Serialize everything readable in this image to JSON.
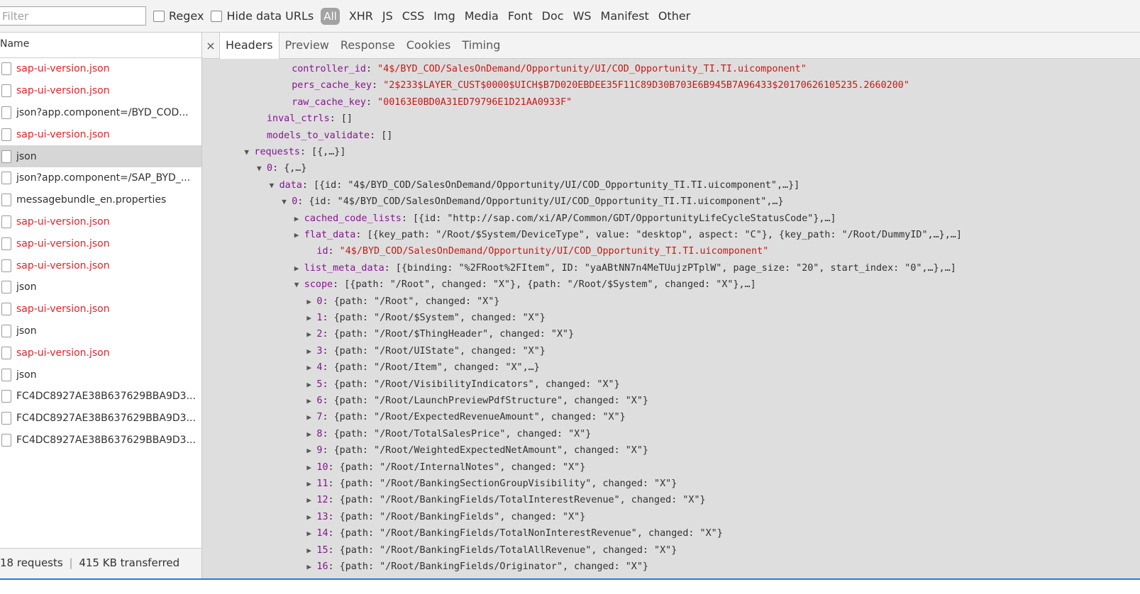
{
  "toolbar": {
    "filter_placeholder": "Filter",
    "regex_label": "Regex",
    "hide_data_urls_label": "Hide data URLs",
    "types": [
      "All",
      "XHR",
      "JS",
      "CSS",
      "Img",
      "Media",
      "Font",
      "Doc",
      "WS",
      "Manifest",
      "Other"
    ],
    "selected_type": "All"
  },
  "requests_panel": {
    "header": "Name",
    "items": [
      {
        "name": "sap-ui-version.json",
        "error": true
      },
      {
        "name": "sap-ui-version.json",
        "error": true
      },
      {
        "name": "json?app.component=/BYD_COD...",
        "error": false
      },
      {
        "name": "sap-ui-version.json",
        "error": true
      },
      {
        "name": "json",
        "error": false,
        "selected": true
      },
      {
        "name": "json?app.component=/SAP_BYD_...",
        "error": false
      },
      {
        "name": "messagebundle_en.properties",
        "error": false
      },
      {
        "name": "sap-ui-version.json",
        "error": true
      },
      {
        "name": "sap-ui-version.json",
        "error": true
      },
      {
        "name": "sap-ui-version.json",
        "error": true
      },
      {
        "name": "json",
        "error": false
      },
      {
        "name": "sap-ui-version.json",
        "error": true
      },
      {
        "name": "json",
        "error": false
      },
      {
        "name": "sap-ui-version.json",
        "error": true
      },
      {
        "name": "json",
        "error": false
      },
      {
        "name": "FC4DC8927AE38B637629BBA9D3...",
        "error": false
      },
      {
        "name": "FC4DC8927AE38B637629BBA9D3...",
        "error": false
      },
      {
        "name": "FC4DC8927AE38B637629BBA9D3...",
        "error": false
      }
    ],
    "summary_requests": "18 requests",
    "summary_sep": "|",
    "summary_transferred": "415 KB transferred"
  },
  "details": {
    "close": "×",
    "tabs": [
      "Headers",
      "Preview",
      "Response",
      "Cookies",
      "Timing"
    ],
    "active_tab": "Headers"
  },
  "json_lines": [
    {
      "indent": 7,
      "tri": "",
      "key": "controller_id",
      "sep": ": ",
      "val": "\"4$/BYD_COD/SalesOnDemand/Opportunity/UI/COD_Opportunity_TI.TI.uicomponent\"",
      "vt": "str"
    },
    {
      "indent": 7,
      "tri": "",
      "key": "pers_cache_key",
      "sep": ": ",
      "val": "\"2$233$LAYER_CUST$0000$UICH$B7D020EBDEE35F11C89D30B703E6B945B7A96433$20170626105235.2660200\"",
      "vt": "str"
    },
    {
      "indent": 7,
      "tri": "",
      "key": "raw_cache_key",
      "sep": ": ",
      "val": "\"00163E0BD0A31ED79796E1D21AA0933F\"",
      "vt": "str"
    },
    {
      "indent": 5,
      "tri": "",
      "key": "inval_ctrls",
      "sep": ": ",
      "val": "[]",
      "vt": "pl"
    },
    {
      "indent": 5,
      "tri": "",
      "key": "models_to_validate",
      "sep": ": ",
      "val": "[]",
      "vt": "pl"
    },
    {
      "indent": 4,
      "tri": "▼",
      "key": "requests",
      "sep": ": ",
      "val": "[{,…}]",
      "vt": "pl"
    },
    {
      "indent": 5,
      "tri": "▼",
      "key": "0",
      "sep": ": ",
      "val": "{,…}",
      "vt": "pl"
    },
    {
      "indent": 6,
      "tri": "▼",
      "key": "data",
      "sep": ": ",
      "val": "[{id: \"4$/BYD_COD/SalesOnDemand/Opportunity/UI/COD_Opportunity_TI.TI.uicomponent\",…}]",
      "vt": "pl"
    },
    {
      "indent": 7,
      "tri": "▼",
      "key": "0",
      "sep": ": ",
      "val": "{id: \"4$/BYD_COD/SalesOnDemand/Opportunity/UI/COD_Opportunity_TI.TI.uicomponent\",…}",
      "vt": "pl"
    },
    {
      "indent": 8,
      "tri": "▶",
      "key": "cached_code_lists",
      "sep": ": ",
      "val": "[{id: \"http://sap.com/xi/AP/Common/GDT/OpportunityLifeCycleStatusCode\"},…]",
      "vt": "pl"
    },
    {
      "indent": 8,
      "tri": "▶",
      "key": "flat_data",
      "sep": ": ",
      "val": "[{key_path: \"/Root/$System/DeviceType\", value: \"desktop\", aspect: \"C\"}, {key_path: \"/Root/DummyID\",…},…]",
      "vt": "pl"
    },
    {
      "indent": 9,
      "tri": "",
      "key": "id",
      "sep": ": ",
      "val": "\"4$/BYD_COD/SalesOnDemand/Opportunity/UI/COD_Opportunity_TI.TI.uicomponent\"",
      "vt": "str"
    },
    {
      "indent": 8,
      "tri": "▶",
      "key": "list_meta_data",
      "sep": ": ",
      "val": "[{binding: \"%2FRoot%2FItem\", ID: \"yaABtNN7n4MeTUujzPTplW\", page_size: \"20\", start_index: \"0\",…},…]",
      "vt": "pl"
    },
    {
      "indent": 8,
      "tri": "▼",
      "key": "scope",
      "sep": ": ",
      "val": "[{path: \"/Root\", changed: \"X\"}, {path: \"/Root/$System\", changed: \"X\"},…]",
      "vt": "pl"
    },
    {
      "indent": 9,
      "tri": "▶",
      "key": "0",
      "sep": ": ",
      "val": "{path: \"/Root\", changed: \"X\"}",
      "vt": "pl"
    },
    {
      "indent": 9,
      "tri": "▶",
      "key": "1",
      "sep": ": ",
      "val": "{path: \"/Root/$System\", changed: \"X\"}",
      "vt": "pl"
    },
    {
      "indent": 9,
      "tri": "▶",
      "key": "2",
      "sep": ": ",
      "val": "{path: \"/Root/$ThingHeader\", changed: \"X\"}",
      "vt": "pl"
    },
    {
      "indent": 9,
      "tri": "▶",
      "key": "3",
      "sep": ": ",
      "val": "{path: \"/Root/UIState\", changed: \"X\"}",
      "vt": "pl"
    },
    {
      "indent": 9,
      "tri": "▶",
      "key": "4",
      "sep": ": ",
      "val": "{path: \"/Root/Item\", changed: \"X\",…}",
      "vt": "pl"
    },
    {
      "indent": 9,
      "tri": "▶",
      "key": "5",
      "sep": ": ",
      "val": "{path: \"/Root/VisibilityIndicators\", changed: \"X\"}",
      "vt": "pl"
    },
    {
      "indent": 9,
      "tri": "▶",
      "key": "6",
      "sep": ": ",
      "val": "{path: \"/Root/LaunchPreviewPdfStructure\", changed: \"X\"}",
      "vt": "pl"
    },
    {
      "indent": 9,
      "tri": "▶",
      "key": "7",
      "sep": ": ",
      "val": "{path: \"/Root/ExpectedRevenueAmount\", changed: \"X\"}",
      "vt": "pl"
    },
    {
      "indent": 9,
      "tri": "▶",
      "key": "8",
      "sep": ": ",
      "val": "{path: \"/Root/TotalSalesPrice\", changed: \"X\"}",
      "vt": "pl"
    },
    {
      "indent": 9,
      "tri": "▶",
      "key": "9",
      "sep": ": ",
      "val": "{path: \"/Root/WeightedExpectedNetAmount\", changed: \"X\"}",
      "vt": "pl"
    },
    {
      "indent": 9,
      "tri": "▶",
      "key": "10",
      "sep": ": ",
      "val": "{path: \"/Root/InternalNotes\", changed: \"X\"}",
      "vt": "pl"
    },
    {
      "indent": 9,
      "tri": "▶",
      "key": "11",
      "sep": ": ",
      "val": "{path: \"/Root/BankingSectionGroupVisibility\", changed: \"X\"}",
      "vt": "pl"
    },
    {
      "indent": 9,
      "tri": "▶",
      "key": "12",
      "sep": ": ",
      "val": "{path: \"/Root/BankingFields/TotalInterestRevenue\", changed: \"X\"}",
      "vt": "pl"
    },
    {
      "indent": 9,
      "tri": "▶",
      "key": "13",
      "sep": ": ",
      "val": "{path: \"/Root/BankingFields\", changed: \"X\"}",
      "vt": "pl"
    },
    {
      "indent": 9,
      "tri": "▶",
      "key": "14",
      "sep": ": ",
      "val": "{path: \"/Root/BankingFields/TotalNonInterestRevenue\", changed: \"X\"}",
      "vt": "pl"
    },
    {
      "indent": 9,
      "tri": "▶",
      "key": "15",
      "sep": ": ",
      "val": "{path: \"/Root/BankingFields/TotalAllRevenue\", changed: \"X\"}",
      "vt": "pl"
    },
    {
      "indent": 9,
      "tri": "▶",
      "key": "16",
      "sep": ": ",
      "val": "{path: \"/Root/BankingFields/Originator\", changed: \"X\"}",
      "vt": "pl"
    }
  ],
  "colors": {
    "error_text": "#e0242b",
    "json_key": "#881391",
    "json_string": "#c41a16",
    "selected_row": "#d6d6d6",
    "panel_bg": "#dedede"
  }
}
